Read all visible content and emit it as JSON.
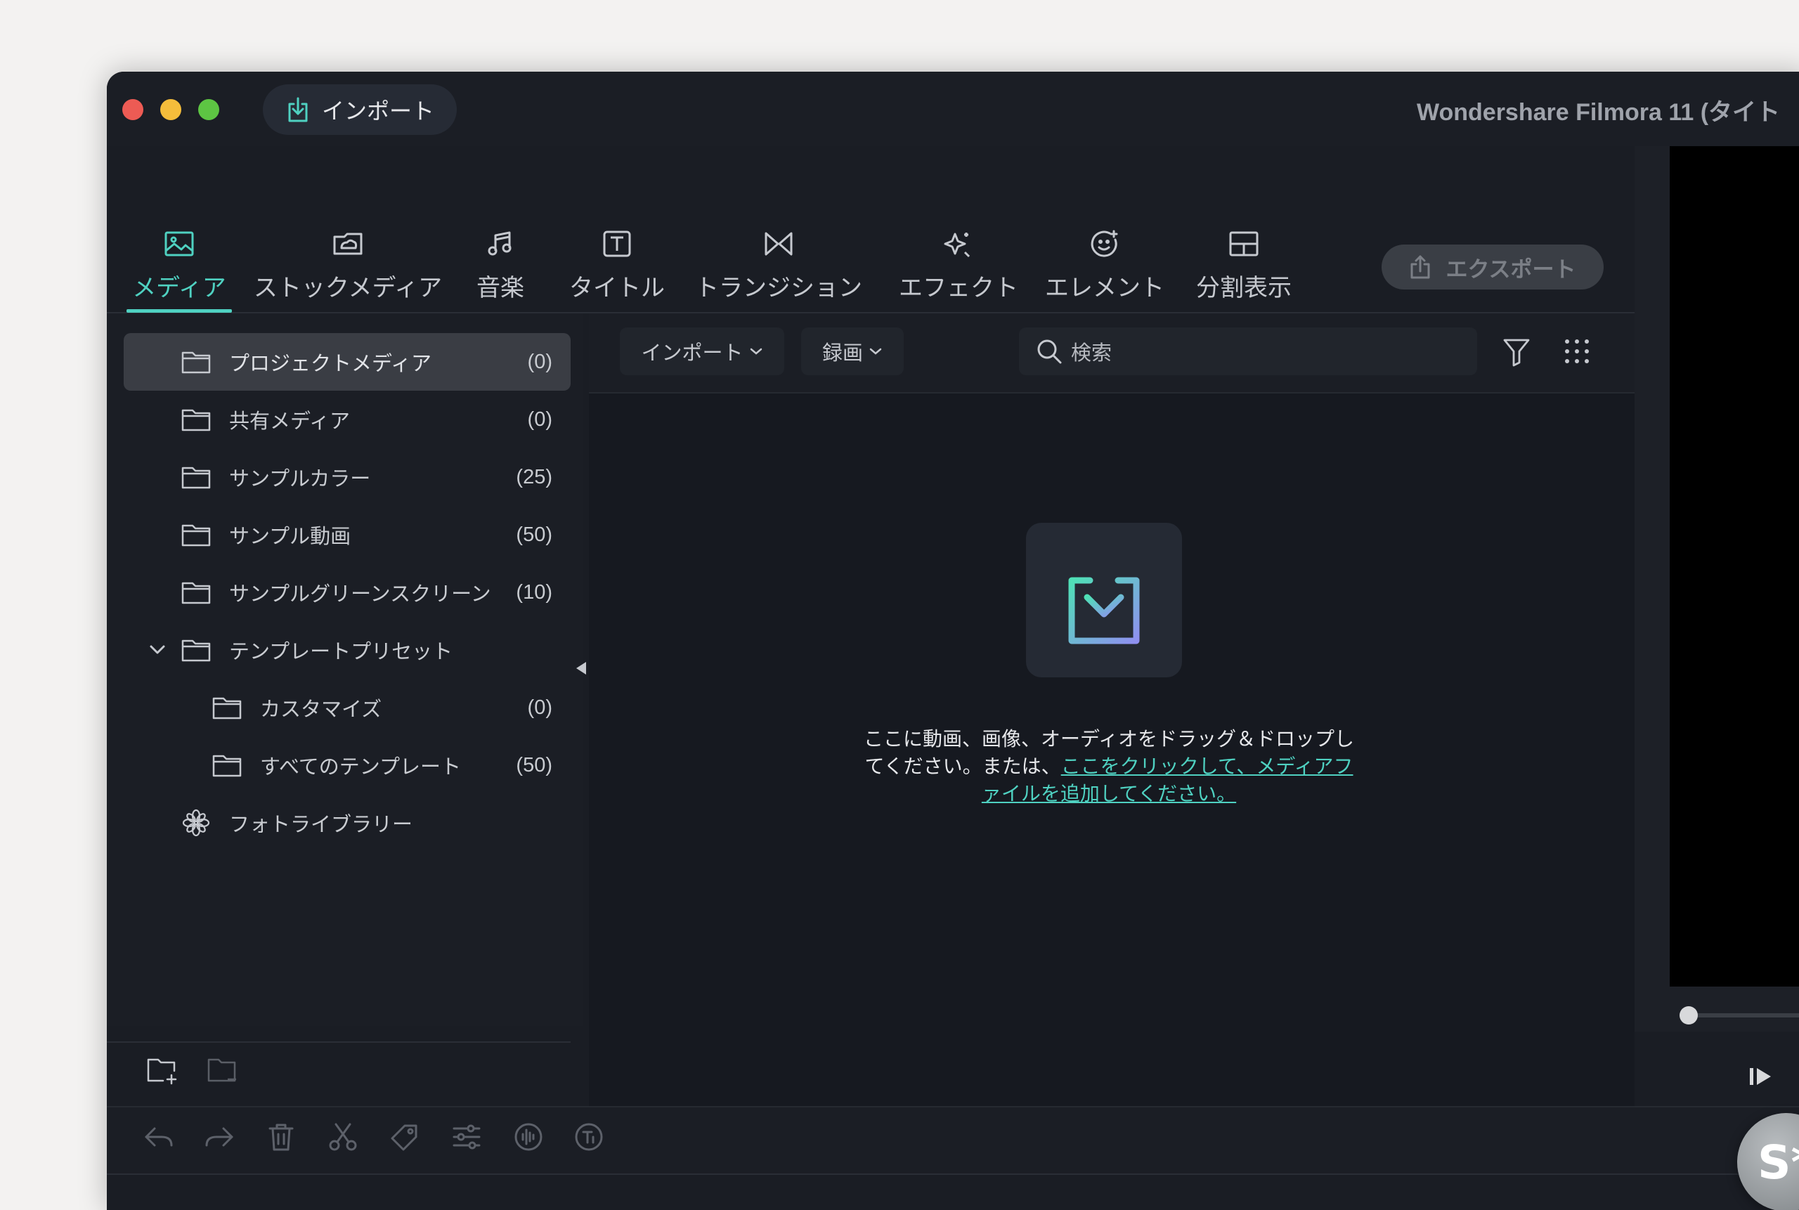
{
  "titlebar": {
    "import_label": "インポート",
    "app_title": "Wondershare Filmora 11 (タイト"
  },
  "tabs": [
    {
      "label": "メディア",
      "icon": "media-icon",
      "active": true
    },
    {
      "label": "ストックメディア",
      "icon": "stock-media-icon",
      "active": false
    },
    {
      "label": "音楽",
      "icon": "music-icon",
      "active": false
    },
    {
      "label": "タイトル",
      "icon": "title-icon",
      "active": false
    },
    {
      "label": "トランジション",
      "icon": "transition-icon",
      "active": false
    },
    {
      "label": "エフェクト",
      "icon": "effect-icon",
      "active": false
    },
    {
      "label": "エレメント",
      "icon": "element-icon",
      "active": false
    },
    {
      "label": "分割表示",
      "icon": "split-screen-icon",
      "active": false
    }
  ],
  "export_label": "エクスポート",
  "sidebar": {
    "items": [
      {
        "name": "プロジェクトメディア",
        "count": "(0)"
      },
      {
        "name": "共有メディア",
        "count": "(0)"
      },
      {
        "name": "サンプルカラー",
        "count": "(25)"
      },
      {
        "name": "サンプル動画",
        "count": "(50)"
      },
      {
        "name": "サンプルグリーンスクリーン",
        "count": "(10)"
      },
      {
        "name": "テンプレートプリセット",
        "count": ""
      },
      {
        "name": "カスタマイズ",
        "count": "(0)"
      },
      {
        "name": "すべてのテンプレート",
        "count": "(50)"
      },
      {
        "name": "フォトライブラリー",
        "count": ""
      }
    ]
  },
  "toolbar": {
    "import_dropdown": "インポート",
    "record_dropdown": "録画",
    "search_placeholder": "検索"
  },
  "drop_zone": {
    "text": "ここに動画、画像、オーディオをドラッグ＆ドロップしてください。または、",
    "link": "ここをクリックして、メディアファイルを追加してください。"
  },
  "avatar_label": "S*",
  "colors": {
    "accent": "#4fd1c1",
    "window_bg": "#1a1d24",
    "traffic_red": "#ed5b54",
    "traffic_yellow": "#f5bd3b",
    "traffic_green": "#5dc543"
  }
}
